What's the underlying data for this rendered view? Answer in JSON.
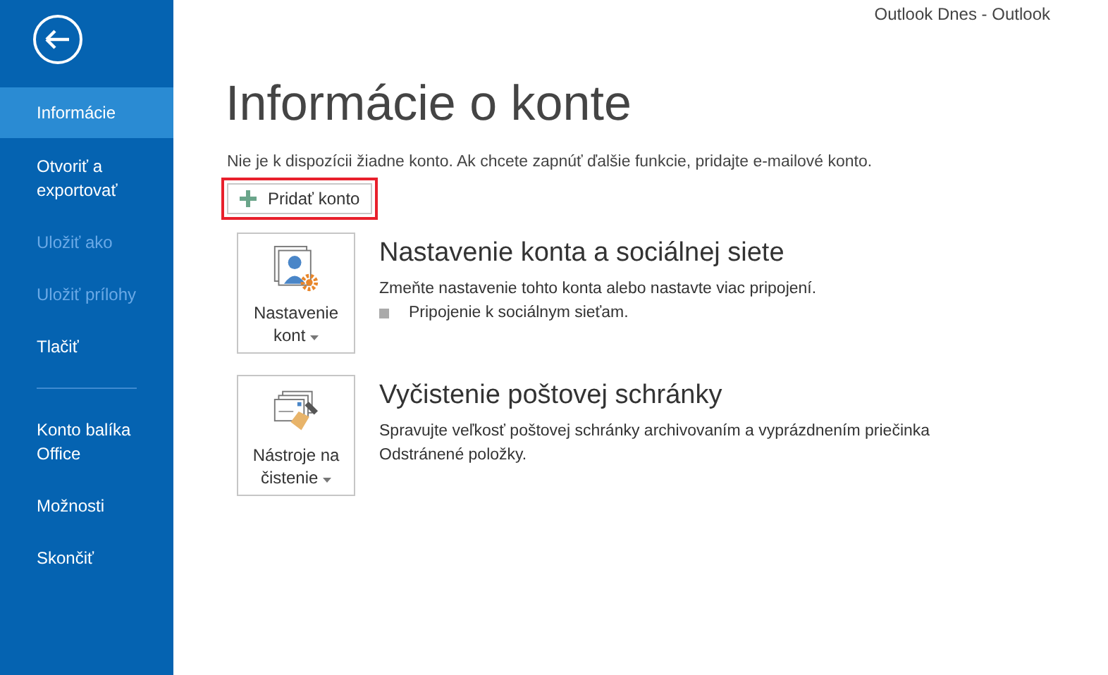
{
  "window": {
    "title": "Outlook Dnes - Outlook"
  },
  "sidebar": {
    "items": [
      {
        "label": "Informácie",
        "selected": true,
        "disabled": false,
        "divider_before": false
      },
      {
        "label": "Otvoriť a exportovať",
        "selected": false,
        "disabled": false,
        "divider_before": false
      },
      {
        "label": "Uložiť ako",
        "selected": false,
        "disabled": true,
        "divider_before": false
      },
      {
        "label": "Uložiť prílohy",
        "selected": false,
        "disabled": true,
        "divider_before": false
      },
      {
        "label": "Tlačiť",
        "selected": false,
        "disabled": false,
        "divider_before": false
      },
      {
        "label": "Konto balíka Office",
        "selected": false,
        "disabled": false,
        "divider_before": true
      },
      {
        "label": "Možnosti",
        "selected": false,
        "disabled": false,
        "divider_before": false
      },
      {
        "label": "Skončiť",
        "selected": false,
        "disabled": false,
        "divider_before": false
      }
    ]
  },
  "page": {
    "heading": "Informácie o konte",
    "message": "Nie je k dispozícii žiadne konto. Ak chcete zapnúť ďalšie funkcie, pridajte e-mailové konto.",
    "add_button": {
      "label": "Pridať konto",
      "highlighted": true
    }
  },
  "sections": [
    {
      "kind": "account",
      "button": "Nastavenie kont",
      "title": "Nastavenie konta a sociálnej siete",
      "description": "Zmeňte nastavenie tohto konta alebo nastavte viac pripojení.",
      "bullets": [
        "Pripojenie k sociálnym sieťam."
      ]
    },
    {
      "kind": "cleanup",
      "button": "Nástroje na čistenie",
      "title": "Vyčistenie poštovej schránky",
      "description": "Spravujte veľkosť poštovej schránky archivovaním a vyprázdnením priečinka Odstránené položky."
    }
  ]
}
